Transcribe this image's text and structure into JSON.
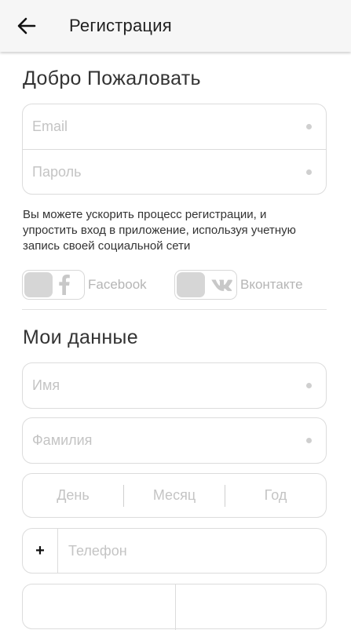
{
  "app_bar": {
    "title": "Регистрация"
  },
  "welcome": {
    "title": "Добро Пожаловать",
    "email_placeholder": "Email",
    "password_placeholder": "Пароль"
  },
  "hint": "Вы можете ускорить процесс регистрации, и упростить вход в приложение, используя учетную запись своей социальной сети",
  "social": {
    "facebook_label": "Facebook",
    "vk_label": "Вконтакте"
  },
  "my_data": {
    "title": "Мои данные",
    "first_name_placeholder": "Имя",
    "last_name_placeholder": "Фамилия",
    "day_placeholder": "День",
    "month_placeholder": "Месяц",
    "year_placeholder": "Год",
    "phone_prefix": "+",
    "phone_placeholder": "Телефон"
  },
  "icons": {
    "back": "arrow-left-icon",
    "facebook": "facebook-icon",
    "vk": "vk-icon"
  }
}
